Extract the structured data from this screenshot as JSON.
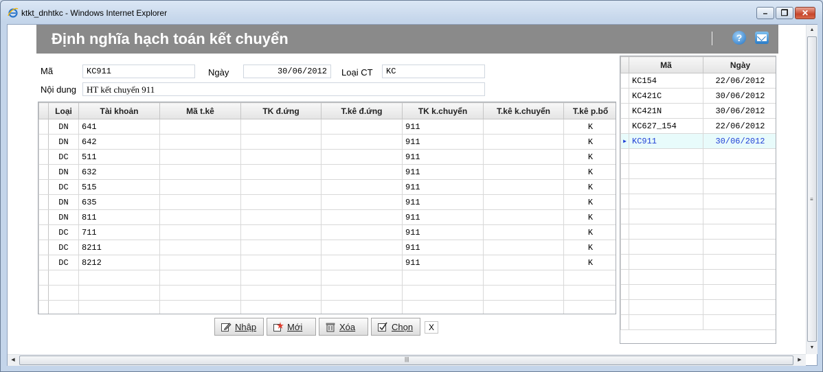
{
  "window": {
    "title": "ktkt_dnhtkc - Windows Internet Explorer"
  },
  "header": {
    "title": "Định nghĩa hạch toán kết chuyển"
  },
  "form": {
    "ma_label": "Mã",
    "ma_value": "KC911",
    "ngay_label": "Ngày",
    "ngay_value": "30/06/2012",
    "loaict_label": "Loại CT",
    "loaict_value": "KC",
    "noidung_label": "Nội dung",
    "noidung_value": "HT kết chuyển 911"
  },
  "grid": {
    "columns": [
      "Loại",
      "Tài khoản",
      "Mã t.kê",
      "TK đ.ứng",
      "T.kê đ.ứng",
      "TK k.chuyển",
      "T.kê k.chuyển",
      "T.kê p.bổ"
    ],
    "rows": [
      [
        "DN",
        "641",
        "",
        "",
        "",
        "911",
        "",
        "K"
      ],
      [
        "DN",
        "642",
        "",
        "",
        "",
        "911",
        "",
        "K"
      ],
      [
        "DC",
        "511",
        "",
        "",
        "",
        "911",
        "",
        "K"
      ],
      [
        "DN",
        "632",
        "",
        "",
        "",
        "911",
        "",
        "K"
      ],
      [
        "DC",
        "515",
        "",
        "",
        "",
        "911",
        "",
        "K"
      ],
      [
        "DN",
        "635",
        "",
        "",
        "",
        "911",
        "",
        "K"
      ],
      [
        "DN",
        "811",
        "",
        "",
        "",
        "911",
        "",
        "K"
      ],
      [
        "DC",
        "711",
        "",
        "",
        "",
        "911",
        "",
        "K"
      ],
      [
        "DC",
        "8211",
        "",
        "",
        "",
        "911",
        "",
        "K"
      ],
      [
        "DC",
        "8212",
        "",
        "",
        "",
        "911",
        "",
        "K"
      ],
      [
        "",
        "",
        "",
        "",
        "",
        "",
        "",
        ""
      ],
      [
        "",
        "",
        "",
        "",
        "",
        "",
        "",
        ""
      ],
      [
        "",
        "",
        "",
        "",
        "",
        "",
        "",
        ""
      ]
    ]
  },
  "buttons": {
    "nhap": "Nhập",
    "moi": "Mới",
    "xoa": "Xóa",
    "chon": "Chọn",
    "x": "X"
  },
  "list": {
    "columns": [
      "Mã",
      "Ngày"
    ],
    "rows": [
      [
        "KC154",
        "22/06/2012"
      ],
      [
        "KC421C",
        "30/06/2012"
      ],
      [
        "KC421N",
        "30/06/2012"
      ],
      [
        "KC627_154",
        "22/06/2012"
      ],
      [
        "KC911",
        "30/06/2012"
      ]
    ],
    "selected_index": 4,
    "empty_rows": 12
  },
  "colors": {
    "header_bg": "#8a8a8a",
    "selected_row_text": "#1f3fd6",
    "selected_row_bg": "#e8fbfb"
  },
  "icons": [
    "ie-icon",
    "minimize-icon",
    "restore-icon",
    "close-icon",
    "help-icon",
    "mail-icon",
    "edit-icon",
    "new-icon",
    "delete-icon",
    "select-icon"
  ]
}
